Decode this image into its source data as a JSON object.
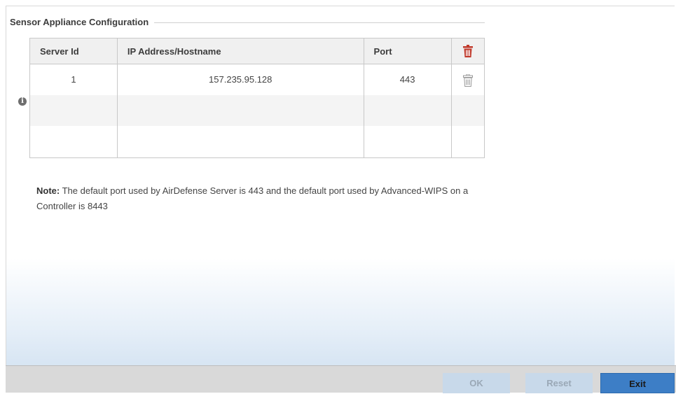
{
  "section": {
    "title": "Sensor Appliance Configuration"
  },
  "table": {
    "columns": [
      "Server Id",
      "IP Address/Hostname",
      "Port"
    ],
    "rows": [
      {
        "server_id": "1",
        "ip": "157.235.95.128",
        "port": "443"
      }
    ]
  },
  "note": {
    "label": "Note:",
    "text": " The default port used by AirDefense Server is 443 and the default port used by Advanced-WIPS on a Controller is 8443"
  },
  "footer": {
    "ok_label": "OK",
    "reset_label": "Reset",
    "exit_label": "Exit"
  },
  "colors": {
    "delete_header_icon": "#c0392b",
    "delete_row_icon": "#9a9a9a",
    "exit_button": "#3d7ec6",
    "disabled_button": "#c8d9ea"
  },
  "icons": [
    "info-icon",
    "trash-icon"
  ]
}
